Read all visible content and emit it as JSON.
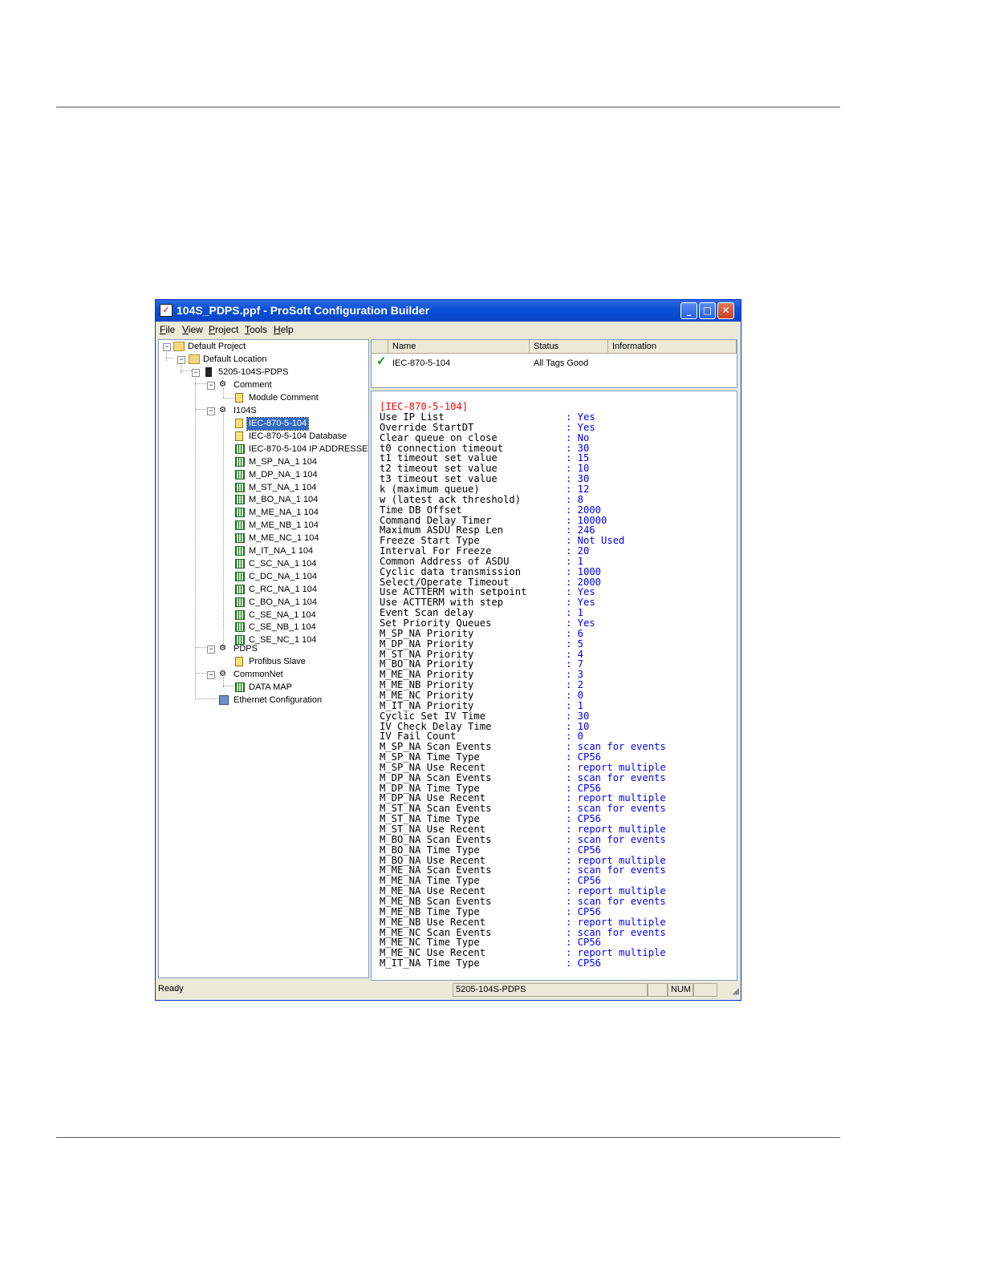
{
  "window": {
    "title": "104S_PDPS.ppf - ProSoft Configuration Builder",
    "minimize_glyph": "_",
    "maximize_glyph": "□",
    "close_glyph": "✕"
  },
  "menu": [
    "File",
    "View",
    "Project",
    "Tools",
    "Help"
  ],
  "tree": {
    "default_project": "Default Project",
    "default_location": "Default Location",
    "module": "5205-104S-PDPS",
    "comment_group": "Comment",
    "module_comment": "Module Comment",
    "i104s_group": "I104S",
    "iec_items": [
      "IEC-870-5-104",
      "IEC-870-5-104 Database",
      "IEC-870-5-104 IP ADDRESSES",
      "M_SP_NA_1 104",
      "M_DP_NA_1 104",
      "M_ST_NA_1 104",
      "M_BO_NA_1 104",
      "M_ME_NA_1 104",
      "M_ME_NB_1 104",
      "M_ME_NC_1 104",
      "M_IT_NA_1 104",
      "C_SC_NA_1 104",
      "C_DC_NA_1 104",
      "C_RC_NA_1 104",
      "C_BO_NA_1 104",
      "C_SE_NA_1 104",
      "C_SE_NB_1 104",
      "C_SE_NC_1 104"
    ],
    "pdps_group": "PDPS",
    "profibus_slave": "Profibus Slave",
    "commonnet_group": "CommonNet",
    "data_map": "DATA MAP",
    "ethernet_config": "Ethernet Configuration"
  },
  "list": {
    "columns": [
      "Name",
      "Status",
      "Information"
    ],
    "rows": [
      {
        "name": "IEC-870-5-104",
        "status": "All Tags Good",
        "information": ""
      }
    ]
  },
  "detail": {
    "section": "[IEC-870-5-104]",
    "params": [
      [
        "Use IP List",
        ": Yes"
      ],
      [
        "Override StartDT",
        ": Yes"
      ],
      [
        "Clear queue on close",
        ": No"
      ],
      [
        "t0 connection timeout",
        ": 30"
      ],
      [
        "t1 timeout set value",
        ": 15"
      ],
      [
        "t2 timeout set value",
        ": 10"
      ],
      [
        "t3 timeout set value",
        ": 30"
      ],
      [
        "k (maximum queue)",
        ": 12"
      ],
      [
        "w (latest ack threshold)",
        ": 8"
      ],
      [
        "Time DB Offset",
        ": 2000"
      ],
      [
        "Command Delay Timer",
        ": 10000"
      ],
      [
        "Maximum ASDU Resp Len",
        ": 246"
      ],
      [
        "Freeze Start Type",
        ": Not Used"
      ],
      [
        "Interval For Freeze",
        ": 20"
      ],
      [
        "Common Address of ASDU",
        ": 1"
      ],
      [
        "Cyclic data transmission",
        ": 1000"
      ],
      [
        "Select/Operate Timeout",
        ": 2000"
      ],
      [
        "Use ACTTERM with setpoint",
        ": Yes"
      ],
      [
        "Use ACTTERM with step",
        ": Yes"
      ],
      [
        "Event Scan delay",
        ": 1"
      ],
      [
        "Set Priority Queues",
        ": Yes"
      ],
      [
        "M_SP_NA Priority",
        ": 6"
      ],
      [
        "M_DP_NA Priority",
        ": 5"
      ],
      [
        "M_ST_NA Priority",
        ": 4"
      ],
      [
        "M_BO_NA Priority",
        ": 7"
      ],
      [
        "M_ME_NA Priority",
        ": 3"
      ],
      [
        "M_ME_NB Priority",
        ": 2"
      ],
      [
        "M_ME_NC Priority",
        ": 0"
      ],
      [
        "M_IT_NA Priority",
        ": 1"
      ],
      [
        "Cyclic Set IV Time",
        ": 30"
      ],
      [
        "IV Check Delay Time",
        ": 10"
      ],
      [
        "IV Fail Count",
        ": 0"
      ],
      [
        "M_SP_NA Scan Events",
        ": scan for events"
      ],
      [
        "M_SP_NA Time Type",
        ": CP56"
      ],
      [
        "M_SP_NA Use Recent",
        ": report multiple"
      ],
      [
        "M_DP_NA Scan Events",
        ": scan for events"
      ],
      [
        "M_DP_NA Time Type",
        ": CP56"
      ],
      [
        "M_DP_NA Use Recent",
        ": report multiple"
      ],
      [
        "M_ST_NA Scan Events",
        ": scan for events"
      ],
      [
        "M_ST_NA Time Type",
        ": CP56"
      ],
      [
        "M_ST_NA Use Recent",
        ": report multiple"
      ],
      [
        "M_BO_NA Scan Events",
        ": scan for events"
      ],
      [
        "M_BO_NA Time Type",
        ": CP56"
      ],
      [
        "M_BO_NA Use Recent",
        ": report multiple"
      ],
      [
        "M_ME_NA Scan Events",
        ": scan for events"
      ],
      [
        "M_ME_NA Time Type",
        ": CP56"
      ],
      [
        "M_ME_NA Use Recent",
        ": report multiple"
      ],
      [
        "M_ME_NB Scan Events",
        ": scan for events"
      ],
      [
        "M_ME_NB Time Type",
        ": CP56"
      ],
      [
        "M_ME_NB Use Recent",
        ": report multiple"
      ],
      [
        "M_ME_NC Scan Events",
        ": scan for events"
      ],
      [
        "M_ME_NC Time Type",
        ": CP56"
      ],
      [
        "M_ME_NC Use Recent",
        ": report multiple"
      ],
      [
        "M_IT_NA Time Type",
        ": CP56"
      ]
    ]
  },
  "statusbar": {
    "ready": "Ready",
    "module": "5205-104S-PDPS",
    "num": "NUM"
  },
  "colors": {
    "title_blue": "#0a4fd6",
    "value_blue": "#0000ff",
    "section_red": "#ff0000",
    "selection": "#316ac5"
  }
}
